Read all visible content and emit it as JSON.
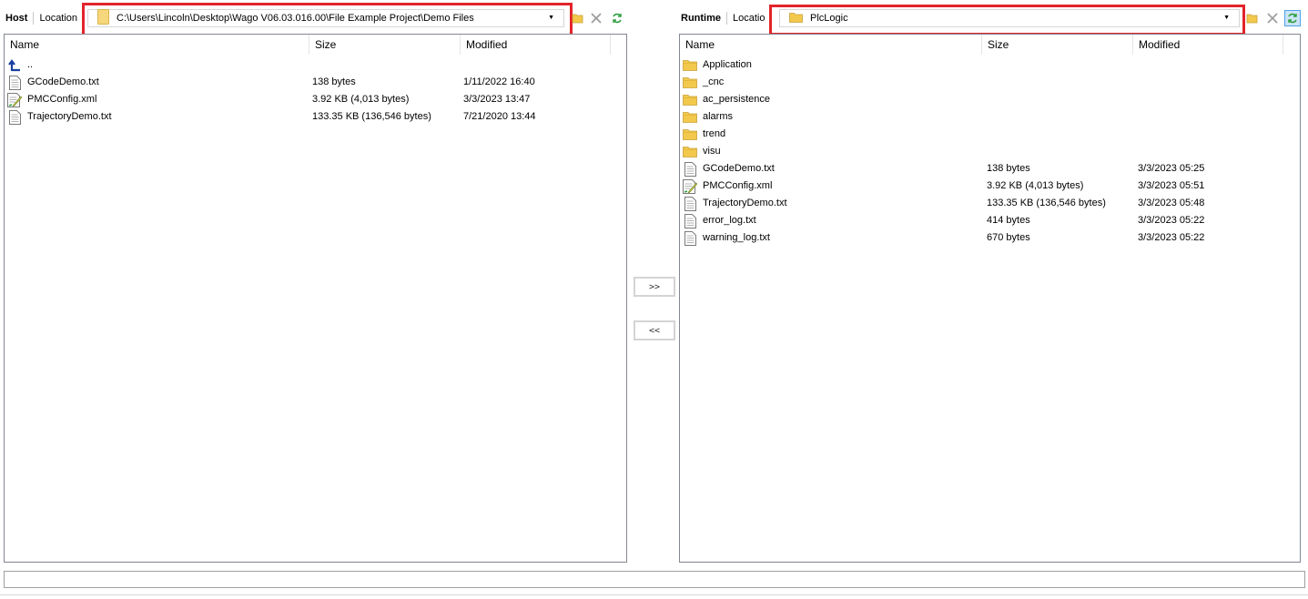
{
  "host": {
    "label": "Host",
    "location_label": "Location",
    "path": "C:\\Users\\Lincoln\\Desktop\\Wago V06.03.016.00\\File Example Project\\Demo Files",
    "columns": {
      "name": "Name",
      "size": "Size",
      "modified": "Modified"
    },
    "rows": [
      {
        "icon": "up-folder-icon",
        "name": "..",
        "size": "",
        "modified": ""
      },
      {
        "icon": "text-file-icon",
        "name": "GCodeDemo.txt",
        "size": "138 bytes",
        "modified": "1/11/2022 16:40"
      },
      {
        "icon": "xml-file-icon",
        "name": "PMCConfig.xml",
        "size": "3.92 KB (4,013 bytes)",
        "modified": "3/3/2023 13:47"
      },
      {
        "icon": "text-file-icon",
        "name": "TrajectoryDemo.txt",
        "size": "133.35 KB (136,546 bytes)",
        "modified": "7/21/2020 13:44"
      }
    ]
  },
  "runtime": {
    "label": "Runtime",
    "location_label": "Locatio",
    "path": "PlcLogic",
    "columns": {
      "name": "Name",
      "size": "Size",
      "modified": "Modified"
    },
    "rows": [
      {
        "icon": "folder-icon",
        "name": "Application",
        "size": "",
        "modified": ""
      },
      {
        "icon": "folder-icon",
        "name": "_cnc",
        "size": "",
        "modified": ""
      },
      {
        "icon": "folder-icon",
        "name": "ac_persistence",
        "size": "",
        "modified": ""
      },
      {
        "icon": "folder-icon",
        "name": "alarms",
        "size": "",
        "modified": ""
      },
      {
        "icon": "folder-icon",
        "name": "trend",
        "size": "",
        "modified": ""
      },
      {
        "icon": "folder-icon",
        "name": "visu",
        "size": "",
        "modified": ""
      },
      {
        "icon": "text-file-icon",
        "name": "GCodeDemo.txt",
        "size": "138 bytes",
        "modified": "3/3/2023 05:25"
      },
      {
        "icon": "xml-file-icon",
        "name": "PMCConfig.xml",
        "size": "3.92 KB (4,013 bytes)",
        "modified": "3/3/2023 05:51"
      },
      {
        "icon": "text-file-icon",
        "name": "TrajectoryDemo.txt",
        "size": "133.35 KB (136,546 bytes)",
        "modified": "3/3/2023 05:48"
      },
      {
        "icon": "text-file-icon",
        "name": "error_log.txt",
        "size": "414 bytes",
        "modified": "3/3/2023 05:22"
      },
      {
        "icon": "text-file-icon",
        "name": "warning_log.txt",
        "size": "670 bytes",
        "modified": "3/3/2023 05:22"
      }
    ]
  },
  "transfer": {
    "to_runtime": ">>",
    "to_host": "<<"
  },
  "colors": {
    "highlight_box": "#e3232a",
    "folder": "#f2c94c",
    "refresh": "#2e9e3f"
  }
}
